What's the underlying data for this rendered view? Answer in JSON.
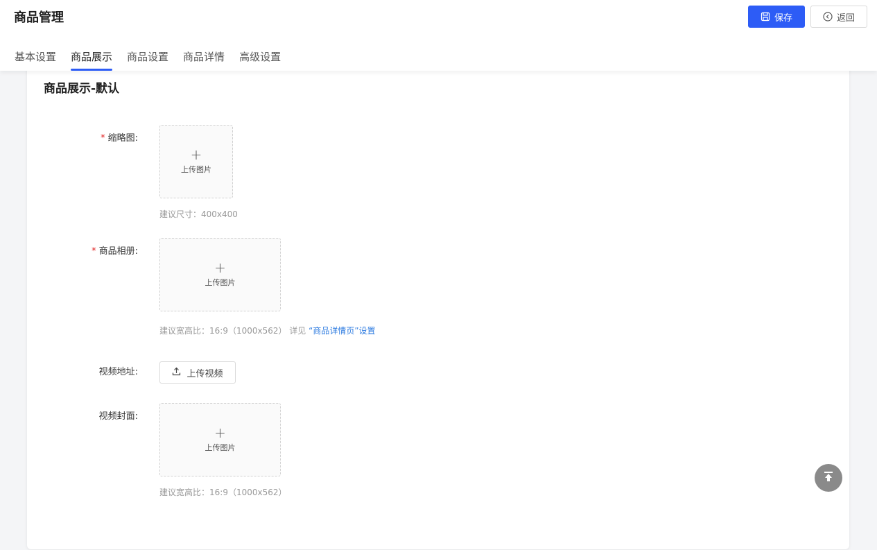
{
  "header": {
    "title": "商品管理",
    "save_label": "保存",
    "back_label": "返回"
  },
  "tabs": [
    {
      "label": "基本设置",
      "active": false
    },
    {
      "label": "商品展示",
      "active": true
    },
    {
      "label": "商品设置",
      "active": false
    },
    {
      "label": "商品详情",
      "active": false
    },
    {
      "label": "高级设置",
      "active": false
    }
  ],
  "section": {
    "title": "商品展示-默认"
  },
  "fields": {
    "thumbnail": {
      "label": "缩略图:",
      "required": true,
      "upload_plus": "+",
      "upload_text": "上传图片",
      "hint": "建议尺寸：400x400"
    },
    "album": {
      "label": "商品相册:",
      "required": true,
      "upload_plus": "+",
      "upload_text": "上传图片",
      "hint_prefix": "建议宽高比：16:9（1000x562） 详见 ",
      "hint_link": "“商品详情页”设置"
    },
    "video": {
      "label": "视频地址:",
      "button_label": "上传视频"
    },
    "video_cover": {
      "label": "视频封面:",
      "upload_plus": "+",
      "upload_text": "上传图片",
      "hint": "建议宽高比：16:9（1000x562）"
    }
  },
  "required_mark": "*",
  "colors": {
    "primary": "#2d5cf6",
    "required": "#e02020",
    "link": "#2d7be0",
    "back_top": "#8a8a8a"
  },
  "icons": {
    "save": "save-icon",
    "back": "circle-chevron-left-icon",
    "upload": "upload-icon",
    "back_top": "arrow-to-top-icon"
  }
}
